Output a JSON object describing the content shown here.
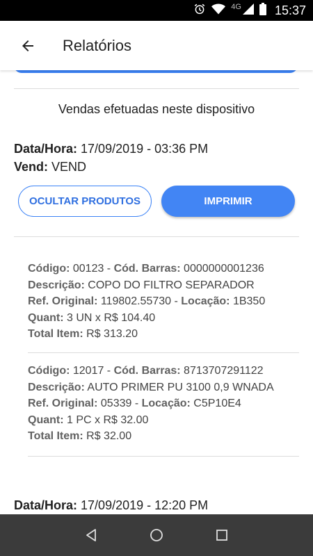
{
  "status_bar": {
    "network": "4G",
    "time": "15:37"
  },
  "app_bar": {
    "title": "Relatórios"
  },
  "section": {
    "title": "Vendas efetuadas neste dispositivo"
  },
  "sale1": {
    "datetime_label": "Data/Hora:",
    "datetime_value": " 17/09/2019 - 03:36 PM",
    "vend_label": "Vend:",
    "vend_value": " VEND"
  },
  "buttons": {
    "hide_products": "OCULTAR PRODUTOS",
    "print": "IMPRIMIR"
  },
  "labels": {
    "codigo": "Código:",
    "cod_barras": "Cód. Barras:",
    "descricao": "Descrição:",
    "ref_original": "Ref. Original:",
    "locacao": "Locação:",
    "quant": "Quant:",
    "total_item": "Total Item:",
    "sep": " - "
  },
  "items": [
    {
      "codigo": " 00123",
      "cod_barras": " 0000000001236",
      "descricao": " COPO DO FILTRO SEPARADOR",
      "ref_original": " 119802.55730",
      "locacao": " 1B350",
      "quant": " 3 UN x R$ 104.40",
      "total_item": " R$ 313.20"
    },
    {
      "codigo": " 12017",
      "cod_barras": " 8713707291122",
      "descricao": " AUTO PRIMER PU 3100 0,9 WNADA",
      "ref_original": " 05339",
      "locacao": " C5P10E4",
      "quant": " 1 PC x R$ 32.00",
      "total_item": " R$ 32.00"
    }
  ],
  "sale2": {
    "datetime_label": "Data/Hora:",
    "datetime_value": " 17/09/2019 - 12:20 PM"
  },
  "colors": {
    "accent": "#4285f4",
    "status_bar": "#000000",
    "nav_bar": "#3b3b3b"
  }
}
